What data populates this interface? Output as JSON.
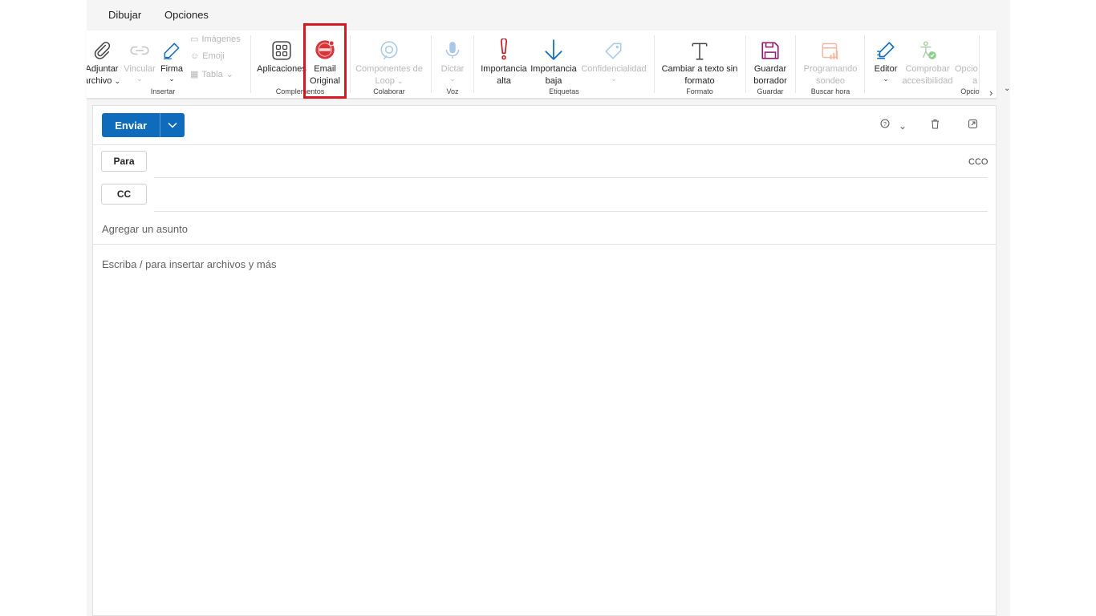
{
  "tabs": {
    "draw": "Dibujar",
    "options": "Opciones"
  },
  "ribbon": {
    "attach": {
      "line1": "Adjuntar",
      "line2": "archivo"
    },
    "link": "Vincular",
    "signature": "Firma",
    "images": "Imágenes",
    "emoji": "Emoji",
    "table": "Tabla",
    "group_insert": "Insertar",
    "apps": "Aplicaciones",
    "email_original": {
      "line1": "Email",
      "line2": "Original"
    },
    "group_complements": "Complementos",
    "loop": {
      "line1": "Componentes de",
      "line2": "Loop"
    },
    "group_collab": "Colaborar",
    "dictate": "Dictar",
    "group_voice": "Voz",
    "high_importance": {
      "line1": "Importancia",
      "line2": "alta"
    },
    "low_importance": {
      "line1": "Importancia",
      "line2": "baja"
    },
    "sensitivity": "Confidencialidad",
    "group_tags": "Etiquetas",
    "plain_text": {
      "line1": "Cambiar a texto sin",
      "line2": "formato"
    },
    "group_format": "Formato",
    "save_draft": {
      "line1": "Guardar",
      "line2": "borrador"
    },
    "group_save": "Guardar",
    "poll": {
      "line1": "Programando",
      "line2": "sondeo"
    },
    "group_find_time": "Buscar hora",
    "editor": "Editor",
    "accessibility": {
      "line1": "Comprobar",
      "line2": "accesibilidad"
    },
    "options": {
      "line1": "Opcio",
      "line2": "a"
    },
    "group_options": "Opcio"
  },
  "compose": {
    "send": "Enviar",
    "to": "Para",
    "cc": "CC",
    "bcc": "CCO",
    "subject_placeholder": "Agregar un asunto",
    "body_placeholder": "Escriba / para insertar archivos y más"
  },
  "colors": {
    "accent": "#0f6cbd",
    "highlight": "#d11b24",
    "importance_high": "#c50f1f",
    "save_purple": "#8f1a6e",
    "editor_blue": "#0f6cbd"
  }
}
